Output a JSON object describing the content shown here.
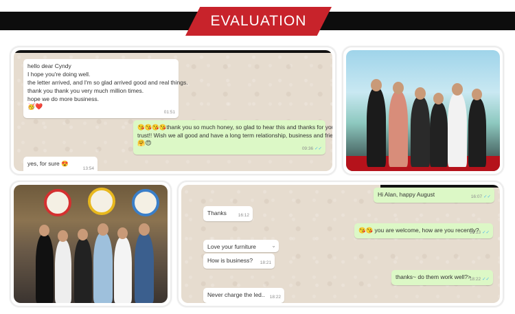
{
  "header": {
    "title": "EVALUATION"
  },
  "chat1": {
    "messages": [
      {
        "dir": "in",
        "lines": [
          "hello dear Cyndy",
          "I hope you're doing well.",
          "the letter arrived, and I'm so glad arrived good and real things.",
          "thank you thank you very much million times.",
          "hope we do more business.",
          "🥳❤️"
        ],
        "time": "01:51"
      },
      {
        "dir": "out",
        "lines": [
          "😘😘😘😘thank you so much honey, so glad to hear this and thanks for your",
          "trust!! Wish we all good and have a long term relationship, business and friends",
          "🤗😍"
        ],
        "time": "09:36"
      },
      {
        "dir": "in",
        "lines": [
          "yes, for sure 😍"
        ],
        "time": "13:54"
      }
    ]
  },
  "chat2": {
    "messages": [
      {
        "dir": "out",
        "text": "Hi Alan, happy August",
        "time": "16:07"
      },
      {
        "dir": "in",
        "text": "Thanks",
        "time": "16:12"
      },
      {
        "dir": "out",
        "text": "😘😘 you are welcome, how are you recently?",
        "time": "16:13"
      },
      {
        "dir": "in",
        "text": "Love your furniture",
        "time": ""
      },
      {
        "dir": "in",
        "text": "How is business?",
        "time": "18:21"
      },
      {
        "dir": "out",
        "text": "thanks~ do them work well?>",
        "time": "18:22"
      },
      {
        "dir": "in",
        "text": "Never charge the led..",
        "time": "18:22"
      }
    ]
  }
}
